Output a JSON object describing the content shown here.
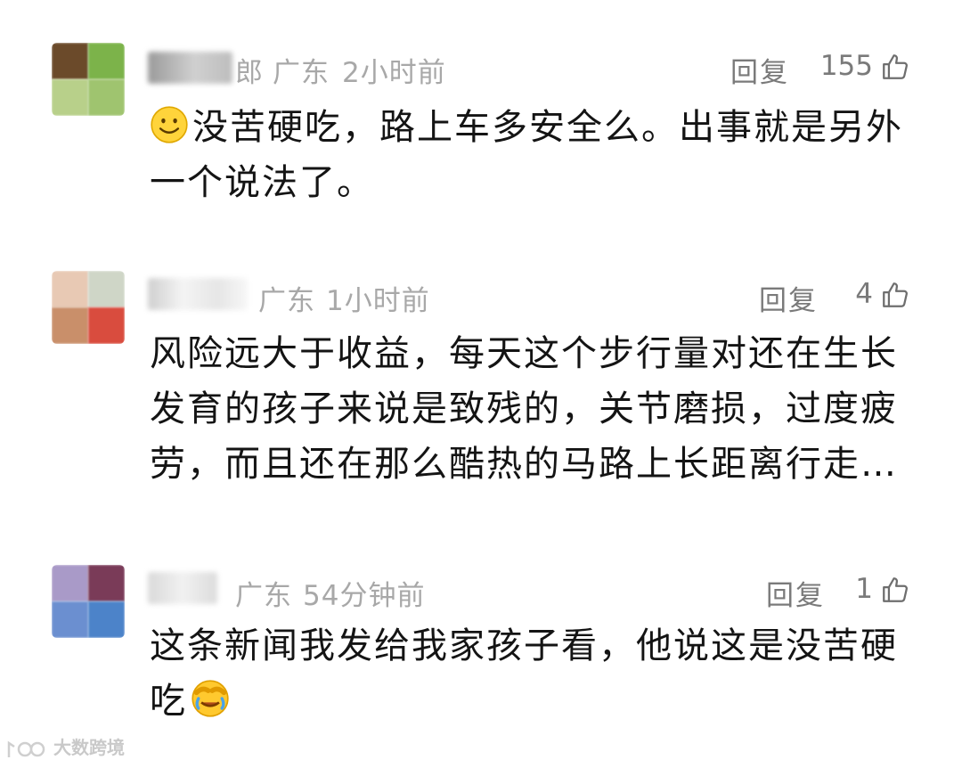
{
  "comments": [
    {
      "name_fragment": "郎",
      "location": "广东",
      "time": "2小时前",
      "reply_label": "回复",
      "likes": "155",
      "lines": [
        "没苦硬吃，路上车多安全么。出事就是另外",
        "一个说法了。"
      ],
      "leading_emoji": "smile-emoji",
      "avatar_colors": [
        "#6b4a2a",
        "#7cb34a",
        "#b8d08a",
        "#9fc46f"
      ]
    },
    {
      "name_fragment": "",
      "location": "广东",
      "time": "1小时前",
      "reply_label": "回复",
      "likes": "4",
      "lines": [
        "风险远大于收益，每天这个步行量对还在生长",
        "发育的孩子来说是致残的，关节磨损，过度疲",
        "劳，而且还在那么酷热的马路上长距离行走…"
      ],
      "avatar_colors": [
        "#e8c9b4",
        "#cfd6c7",
        "#c98f6a",
        "#d94c3e"
      ]
    },
    {
      "name_fragment": "",
      "location": "广东",
      "time": "54分钟前",
      "reply_label": "回复",
      "likes": "1",
      "lines": [
        "这条新闻我发给我家孩子看，他说这是没苦硬",
        "吃"
      ],
      "trailing_emoji": "facepalm-cry-emoji",
      "avatar_colors": [
        "#a99ac8",
        "#7a3b58",
        "#6b8fd0",
        "#4c83c9"
      ]
    }
  ],
  "watermark": {
    "logo": "大数跨境"
  }
}
